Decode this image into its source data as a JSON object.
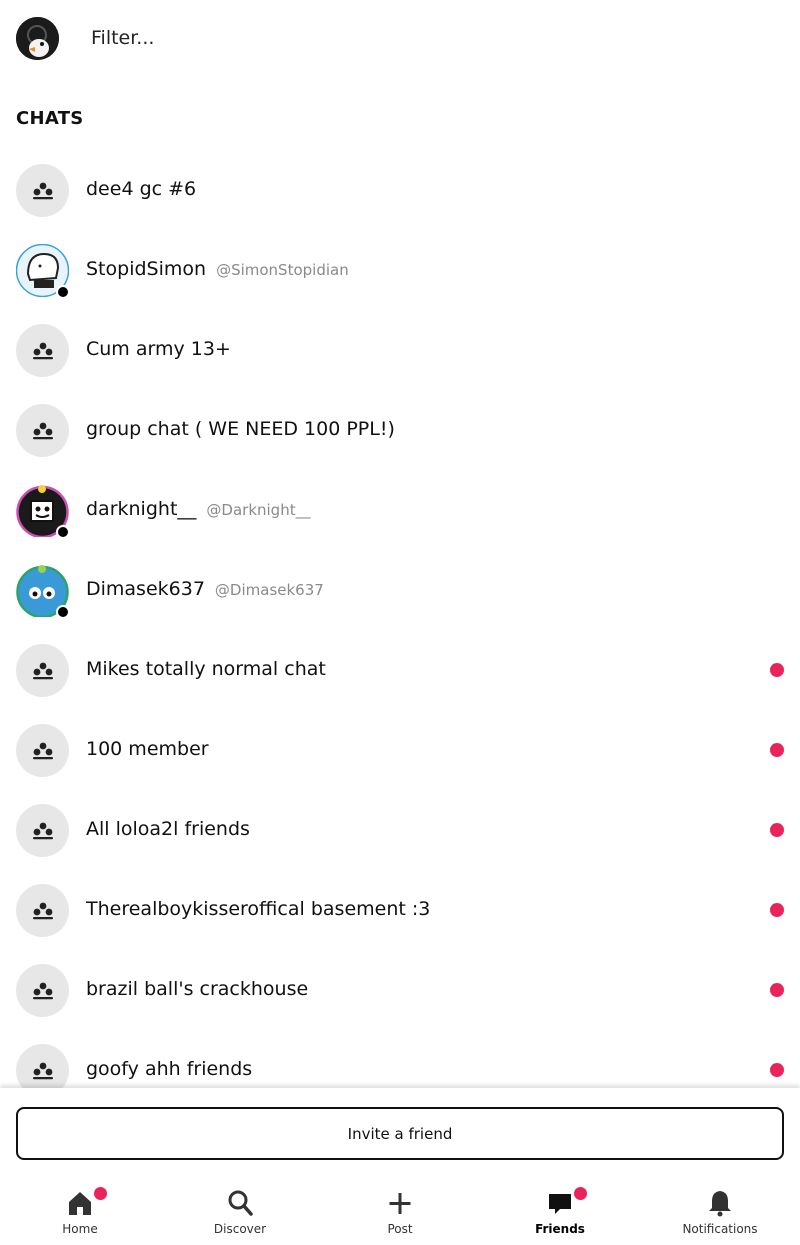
{
  "header": {
    "filter_placeholder": "Filter...",
    "avatar_icon": "user-avatar-goose"
  },
  "section_title": "CHATS",
  "chats": [
    {
      "name": "dee4 gc #6",
      "handle": "",
      "type": "group",
      "unread": false,
      "online": false
    },
    {
      "name": "StopidSimon",
      "handle": "@SimonStopidian",
      "type": "user",
      "unread": false,
      "online": true
    },
    {
      "name": "Cum army 13+",
      "handle": "",
      "type": "group",
      "unread": false,
      "online": false
    },
    {
      "name": "group chat ( WE NEED 100 PPL!)",
      "handle": "",
      "type": "group",
      "unread": false,
      "online": false
    },
    {
      "name": "darknight__",
      "handle": "@Darknight__",
      "type": "user",
      "unread": false,
      "online": true
    },
    {
      "name": "Dimasek637",
      "handle": "@Dimasek637",
      "type": "user",
      "unread": false,
      "online": true
    },
    {
      "name": "Mikes totally normal chat",
      "handle": "",
      "type": "group",
      "unread": true,
      "online": false
    },
    {
      "name": "100 member",
      "handle": "",
      "type": "group",
      "unread": true,
      "online": false
    },
    {
      "name": "All loloa2l friends",
      "handle": "",
      "type": "group",
      "unread": true,
      "online": false
    },
    {
      "name": "Therealboykisseroffical basement :3",
      "handle": "",
      "type": "group",
      "unread": true,
      "online": false
    },
    {
      "name": "brazil ball's crackhouse",
      "handle": "",
      "type": "group",
      "unread": true,
      "online": false
    },
    {
      "name": "goofy ahh friends",
      "handle": "",
      "type": "group",
      "unread": true,
      "online": false
    }
  ],
  "invite_label": "Invite a friend",
  "nav": [
    {
      "label": "Home",
      "icon": "home-icon",
      "badge": true,
      "active": false
    },
    {
      "label": "Discover",
      "icon": "search-icon",
      "badge": false,
      "active": false
    },
    {
      "label": "Post",
      "icon": "plus-icon",
      "badge": false,
      "active": false
    },
    {
      "label": "Friends",
      "icon": "chat-icon",
      "badge": true,
      "active": true
    },
    {
      "label": "Notifications",
      "icon": "bell-icon",
      "badge": false,
      "active": false
    }
  ],
  "colors": {
    "unread_dot": "#e8245a",
    "group_avatar_bg": "#e7e7e7"
  }
}
